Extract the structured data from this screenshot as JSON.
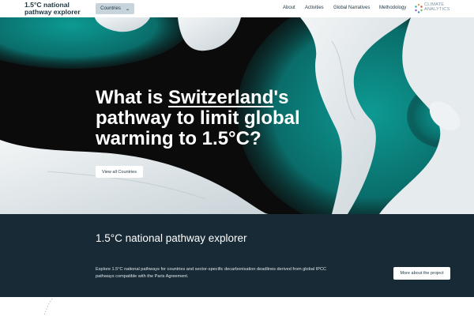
{
  "header": {
    "brand": "1.5°C national pathway explorer",
    "countries_label": "Countries",
    "nav": [
      "About",
      "Activities",
      "Global Narratives",
      "Methodology"
    ],
    "logo_text": "CLIMATE ANALYTICS"
  },
  "hero": {
    "title_prefix": "What is ",
    "country": "Switzerland",
    "title_suffix": "'s pathway to limit global warming to 1.5°C?",
    "view_button": "View all Countries"
  },
  "info": {
    "title": "1.5°C national pathway explorer",
    "description": "Explore 1.5°C national pathways for countries and sector-specific decarbonisation deadlines derived from global IPCC pathways compatible with the Paris Agreement.",
    "more_button": "More about the project"
  },
  "colors": {
    "navy": "#1d3443",
    "info_bg": "#172a36",
    "teal": "#0c8f8a",
    "countries_bg": "#c7d4dc"
  }
}
